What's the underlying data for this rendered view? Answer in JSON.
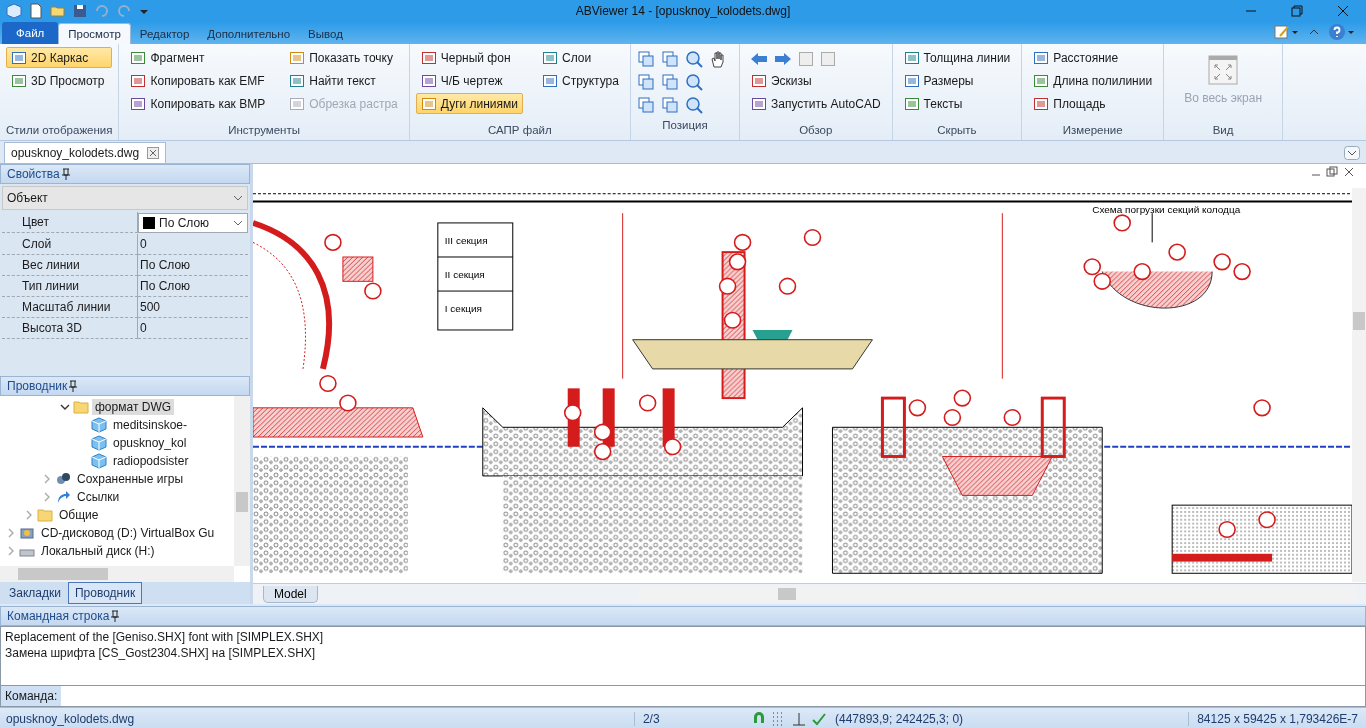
{
  "window": {
    "title": "ABViewer 14 - [opusknoy_kolodets.dwg]"
  },
  "ribbon_tabs": [
    {
      "label": "Файл",
      "kind": "file",
      "selected": false
    },
    {
      "label": "Просмотр",
      "kind": "tab",
      "selected": true
    },
    {
      "label": "Редактор",
      "kind": "tab",
      "selected": false
    },
    {
      "label": "Дополнительно",
      "kind": "tab",
      "selected": false
    },
    {
      "label": "Вывод",
      "kind": "tab",
      "selected": false
    }
  ],
  "ribbon_groups": [
    {
      "title": "Стили отображения",
      "kind": "list",
      "items": [
        {
          "label": "2D Каркас",
          "on": true,
          "disabled": false
        },
        {
          "label": "3D Просмотр",
          "on": false,
          "disabled": false
        }
      ]
    },
    {
      "title": "Инструменты",
      "kind": "list",
      "items": [
        {
          "label": "Фрагмент",
          "on": false,
          "disabled": false
        },
        {
          "label": "Копировать как EMF",
          "on": false,
          "disabled": false
        },
        {
          "label": "Копировать как BMP",
          "on": false,
          "disabled": false
        },
        {
          "label": "Показать точку",
          "on": false,
          "disabled": false
        },
        {
          "label": "Найти текст",
          "on": false,
          "disabled": false
        },
        {
          "label": "Обрезка растра",
          "on": false,
          "disabled": true
        }
      ]
    },
    {
      "title": "САПР файл",
      "kind": "list",
      "items": [
        {
          "label": "Черный фон",
          "on": false,
          "disabled": false
        },
        {
          "label": "Ч/Б чертеж",
          "on": false,
          "disabled": false
        },
        {
          "label": "Дуги линиями",
          "on": true,
          "disabled": false
        },
        {
          "label": "Слои",
          "on": false,
          "disabled": false
        },
        {
          "label": "Структура",
          "on": false,
          "disabled": false
        }
      ]
    },
    {
      "title": "Позиция",
      "kind": "icon-grid"
    },
    {
      "title": "Обзор",
      "kind": "nav-list",
      "items": [
        {
          "label": "Эскизы",
          "on": false,
          "disabled": false
        },
        {
          "label": "Запустить AutoCAD",
          "on": false,
          "disabled": false
        }
      ]
    },
    {
      "title": "Скрыть",
      "kind": "list",
      "items": [
        {
          "label": "Толщина линии",
          "on": false,
          "disabled": false
        },
        {
          "label": "Размеры",
          "on": false,
          "disabled": false
        },
        {
          "label": "Тексты",
          "on": false,
          "disabled": false
        }
      ]
    },
    {
      "title": "Измерение",
      "kind": "list",
      "items": [
        {
          "label": "Расстояние",
          "on": false,
          "disabled": false
        },
        {
          "label": "Длина полилинии",
          "on": false,
          "disabled": false
        },
        {
          "label": "Площадь",
          "on": false,
          "disabled": false
        }
      ]
    },
    {
      "title": "Вид",
      "kind": "large",
      "items": [
        {
          "label": "Во весь экран",
          "on": false,
          "disabled": true
        }
      ]
    }
  ],
  "document_tabs": [
    {
      "label": "opusknoy_kolodets.dwg",
      "selected": true
    }
  ],
  "properties": {
    "title": "Свойства",
    "object": "Объект",
    "rows": [
      {
        "name": "Цвет",
        "value": "По Слою",
        "kind": "color-dropdown"
      },
      {
        "name": "Слой",
        "value": "0",
        "kind": "text"
      },
      {
        "name": "Вес линии",
        "value": "По Слою",
        "kind": "text"
      },
      {
        "name": "Тип линии",
        "value": "По Слою",
        "kind": "text"
      },
      {
        "name": "Масштаб линии",
        "value": "500",
        "kind": "text"
      },
      {
        "name": "Высота 3D",
        "value": "0",
        "kind": "text"
      }
    ]
  },
  "explorer": {
    "title": "Проводник",
    "tree": [
      {
        "children": [
          {
            "children": [
              {
                "children": [
                  {
                    "label": "формат DWG",
                    "kind": "folder",
                    "expanded": true,
                    "selected": true,
                    "children": [
                      {
                        "label": "meditsinskoe-",
                        "kind": "file",
                        "selected": false
                      },
                      {
                        "label": "opusknoy_kol",
                        "kind": "file",
                        "selected": false
                      },
                      {
                        "label": "radiopodsister",
                        "kind": "file",
                        "selected": false
                      }
                    ]
                  }
                ]
              },
              {
                "label": "Сохраненные игры",
                "kind": "games",
                "expanded": false,
                "selected": false
              },
              {
                "label": "Ссылки",
                "kind": "link",
                "expanded": false,
                "selected": false
              }
            ]
          },
          {
            "label": "Общие",
            "kind": "folder",
            "expanded": false,
            "selected": false
          }
        ]
      },
      {
        "label": "CD-дисковод (D:) VirtualBox Gu",
        "kind": "cd",
        "expanded": false,
        "selected": false
      },
      {
        "label": "Локальный диск (H:)",
        "kind": "drive",
        "expanded": false,
        "selected": false
      }
    ]
  },
  "panel_tabs": [
    {
      "label": "Закладки",
      "selected": false
    },
    {
      "label": "Проводник",
      "selected": true
    }
  ],
  "drawing": {
    "labels": [
      "III секция",
      "II секция",
      "I секция",
      "Схема погрузки секций колодца"
    ],
    "layout_tab": "Model"
  },
  "command_line": {
    "title": "Командная строка",
    "lines": [
      "Replacement of the [Geniso.SHX] font with [SIMPLEX.SHX]",
      "Замена шрифта [CS_Gost2304.SHX] на [SIMPLEX.SHX]"
    ],
    "prompt": "Команда:"
  },
  "status_bar": {
    "file": "opusknoy_kolodets.dwg",
    "page": "2/3",
    "coordinates": "(447893,9; 242425,3; 0)",
    "dimensions": "84125 x 59425 x 1,793426E-7"
  }
}
